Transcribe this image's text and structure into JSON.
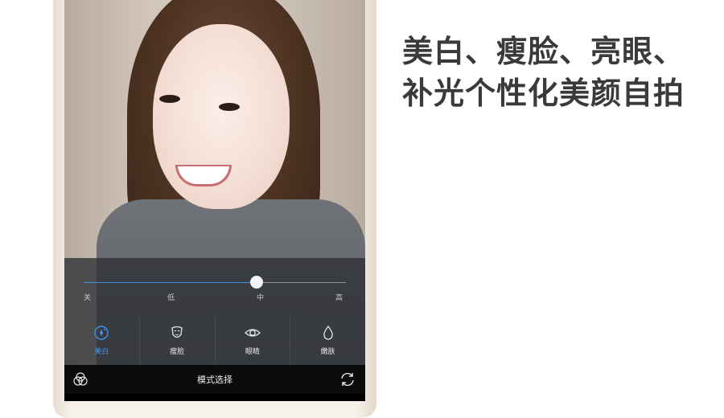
{
  "headline": {
    "line1": "美白、瘦脸、亮眼、",
    "line2": "补光个性化美颜自拍"
  },
  "camera": {
    "slider": {
      "level_fraction": 0.66,
      "labels": [
        "关",
        "低",
        "中",
        "高"
      ]
    },
    "modes": [
      {
        "label": "美白",
        "icon": "whitening-icon",
        "active": true
      },
      {
        "label": "瘦脸",
        "icon": "face-slim-icon",
        "active": false
      },
      {
        "label": "眼睛",
        "icon": "eye-icon",
        "active": false
      },
      {
        "label": "嫩肤",
        "icon": "skin-drop-icon",
        "active": false
      }
    ],
    "bottom_bar": {
      "mode_select_label": "模式选择",
      "left_icon": "filter-circles-icon",
      "right_icon": "switch-camera-icon"
    }
  },
  "colors": {
    "accent": "#3d95ee",
    "headline": "#3a3a3a"
  }
}
